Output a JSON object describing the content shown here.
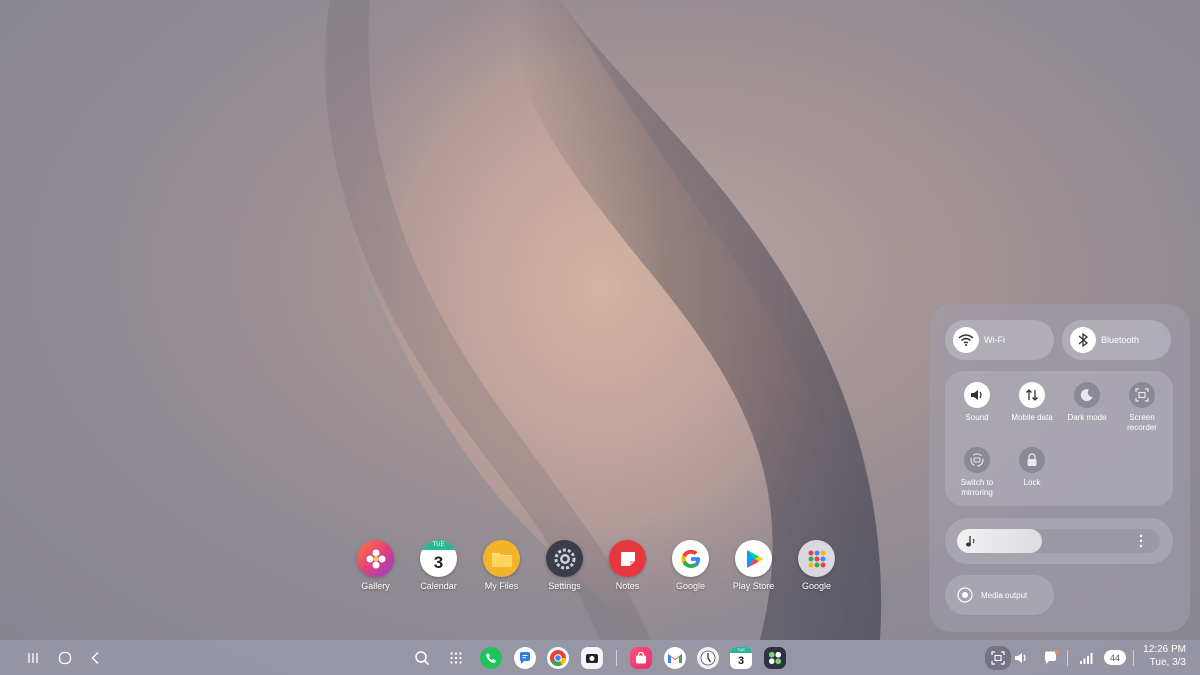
{
  "dock": {
    "apps": [
      {
        "label": "Gallery",
        "icon": "gallery-icon",
        "color": "#e0427a"
      },
      {
        "label": "Calendar",
        "icon": "calendar-icon",
        "color": "#ffffff",
        "day": "TUE",
        "date": "3"
      },
      {
        "label": "My Files",
        "icon": "folder-icon",
        "color": "#f3b42c"
      },
      {
        "label": "Settings",
        "icon": "gear-icon",
        "color": "#3a3d4a"
      },
      {
        "label": "Notes",
        "icon": "notes-icon",
        "color": "#e8363d"
      },
      {
        "label": "Google",
        "icon": "google-icon",
        "color": "#ffffff"
      },
      {
        "label": "Play Store",
        "icon": "play-store-icon",
        "color": "#ffffff"
      },
      {
        "label": "Google",
        "icon": "folder-grid-icon",
        "color": "#d8d8de"
      }
    ]
  },
  "quick_panel": {
    "wifi_label": "Wi-Fi",
    "bluetooth_label": "Bluetooth",
    "tiles": [
      {
        "label": "Sound",
        "state": "on"
      },
      {
        "label": "Mobile data",
        "state": "on"
      },
      {
        "label": "Dark mode",
        "state": "off"
      },
      {
        "label": "Screen recorder",
        "state": "off"
      },
      {
        "label": "Switch to mirroring",
        "state": "off"
      },
      {
        "label": "Lock",
        "state": "off"
      }
    ],
    "volume_level": 0.42,
    "media_output_label": "Media output"
  },
  "taskbar": {
    "battery": "44",
    "time": "12:26 PM",
    "date": "Tue, 3/3",
    "calendar_day": "TUE",
    "calendar_date": "3"
  }
}
